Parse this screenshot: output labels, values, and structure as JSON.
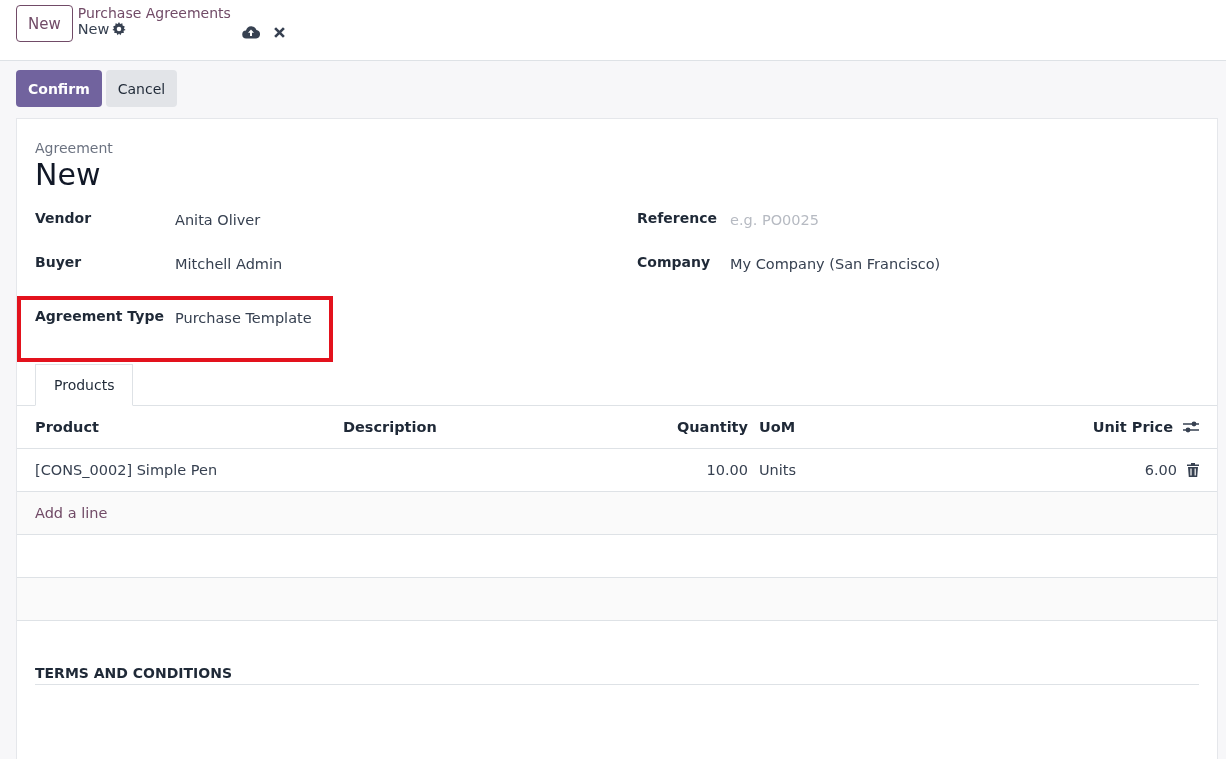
{
  "header": {
    "new_button": "New",
    "breadcrumb": "Purchase Agreements",
    "record": "New"
  },
  "actions": [
    {
      "label": "Confirm",
      "kind": "primary"
    },
    {
      "label": "Cancel",
      "kind": "secondary"
    }
  ],
  "form": {
    "overline": "Agreement",
    "title": "New",
    "left_fields": [
      {
        "label": "Vendor",
        "value": "Anita Oliver",
        "highlighted": false
      },
      {
        "label": "Buyer",
        "value": "Mitchell Admin",
        "highlighted": false
      },
      {
        "label": "Agreement Type",
        "value": "Purchase Template",
        "highlighted": true
      }
    ],
    "right_fields": [
      {
        "label": "Reference",
        "placeholder": "e.g. PO0025"
      },
      {
        "label": "Company",
        "value": "My Company (San Francisco)"
      }
    ]
  },
  "tabs": [
    {
      "label": "Products",
      "selected": true
    }
  ],
  "table": {
    "columns": [
      "Product",
      "Description",
      "Quantity",
      "UoM",
      "Unit Price"
    ],
    "rows": [
      [
        "[CONS_0002] Simple Pen",
        "",
        "10.00",
        "Units",
        "6.00"
      ]
    ],
    "add_line": "Add a line"
  },
  "terms_heading": "TERMS AND CONDITIONS"
}
